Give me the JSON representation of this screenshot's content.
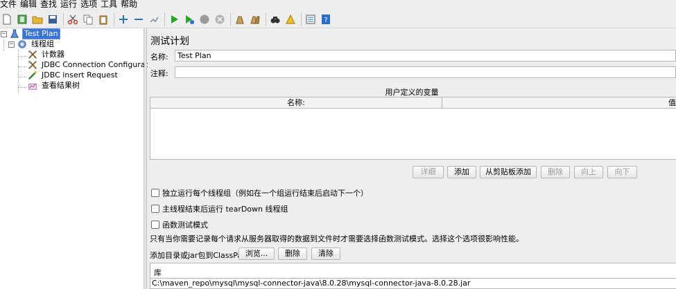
{
  "menu": [
    "文件",
    "编辑",
    "查找",
    "运行",
    "选项",
    "工具",
    "帮助"
  ],
  "toolbar": {
    "groups": [
      [
        "new-icon",
        "templates-icon",
        "open-icon",
        "save-icon"
      ],
      [
        "cut-icon",
        "copy-icon",
        "paste-icon"
      ],
      [
        "expand-icon",
        "collapse-icon",
        "toggle-icon"
      ],
      [
        "start-icon",
        "start-no-pause-icon",
        "stop-icon",
        "shutdown-icon"
      ],
      [
        "clear-icon",
        "clear-all-icon"
      ],
      [
        "search-icon",
        "reset-search-icon"
      ],
      [
        "function-helper-icon",
        "help-icon"
      ]
    ]
  },
  "tree": {
    "nodes": [
      {
        "label": "Test Plan",
        "icon": "test-plan-icon",
        "selected": true
      },
      {
        "label": "线程组",
        "icon": "thread-group-icon",
        "selected": false
      },
      {
        "label": "计数器",
        "icon": "config-element-icon",
        "selected": false
      },
      {
        "label": "JDBC Connection Configuration",
        "icon": "config-element-icon",
        "selected": false
      },
      {
        "label": "JDBC insert Request",
        "icon": "sampler-icon",
        "selected": false
      },
      {
        "label": "查看结果树",
        "icon": "listener-icon",
        "selected": false
      }
    ]
  },
  "main": {
    "title": "测试计划",
    "name_label": "名称:",
    "name_value": "Test Plan",
    "comment_label": "注释:",
    "comment_value": "",
    "vars_caption": "用户定义的变量",
    "vars_columns": [
      "名称:",
      "值"
    ],
    "buttons": {
      "detail": "详细",
      "add": "添加",
      "add_from_clipboard": "从剪贴板添加",
      "delete": "删除",
      "up": "向上",
      "down": "向下"
    },
    "checks": [
      {
        "label": "独立运行每个线程组（例如在一个组运行结束后启动下一个）",
        "checked": false
      },
      {
        "label": "主线程结束后运行 tearDown 线程组",
        "checked": false
      },
      {
        "label": "函数测试模式",
        "checked": false
      }
    ],
    "note": "只有当你需要记录每个请求从服务器取得的数据到文件时才需要选择函数测试模式。选择这个选项很影响性能。",
    "classpath_label": "添加目录或jar包到ClassPath",
    "classpath_buttons": {
      "browse": "浏览...",
      "delete": "删除",
      "clear": "清除"
    },
    "lib_header": "库",
    "lib_rows": [
      "C:\\maven_repo\\mysql\\mysql-connector-java\\8.0.28\\mysql-connector-java-8.0.28.jar"
    ]
  }
}
